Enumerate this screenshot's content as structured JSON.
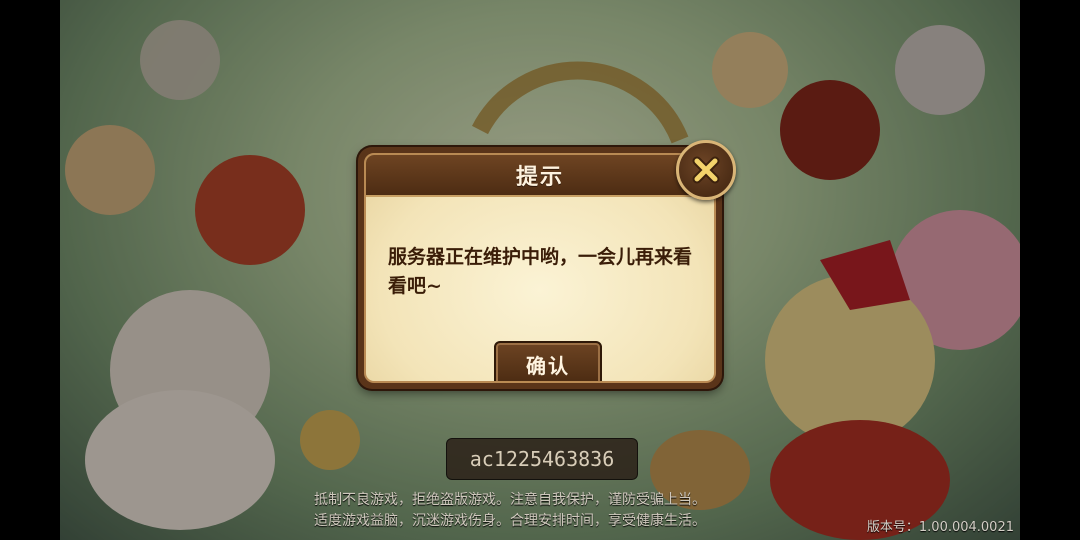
{
  "dialog": {
    "title": "提示",
    "message": "服务器正在维护中哟，一会儿再来看看吧~",
    "confirm_label": "确认",
    "close_icon": "close-x-icon"
  },
  "account": {
    "id": "ac1225463836"
  },
  "footer": {
    "notice_line1": "抵制不良游戏，拒绝盗版游戏。注意自我保护，谨防受骗上当。",
    "notice_line2": "适度游戏益脑，沉迷游戏伤身。合理安排时间，享受健康生活。",
    "version": "版本号：1.00.004.0021"
  },
  "colors": {
    "dialog_frame": "#5a3419",
    "dialog_body": "#f3e4b8",
    "close_ring": "#d9b577",
    "close_x": "#f3d36b"
  }
}
